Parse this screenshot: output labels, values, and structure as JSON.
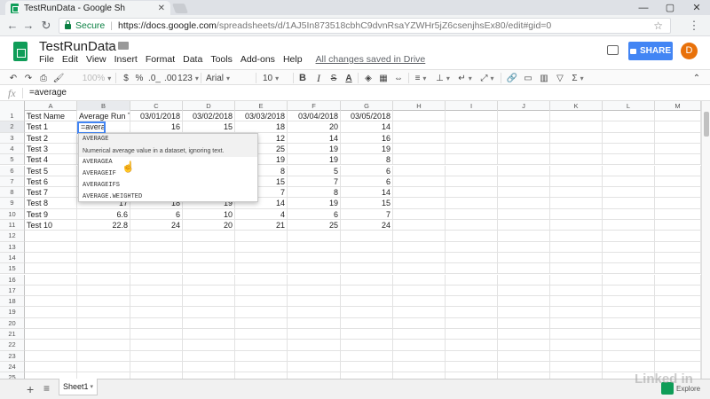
{
  "browser": {
    "tab_title": "TestRunData - Google Sh",
    "tab_close": "✕",
    "secure_label": "Secure",
    "url_host": "https://docs.google.com",
    "url_path": "/spreadsheets/d/1AJ5In873518cbhC9dvnRsaYZWHr5jZ6csenjhsEx80/edit#gid=0"
  },
  "app": {
    "doc_title": "TestRunData",
    "menus": [
      "File",
      "Edit",
      "View",
      "Insert",
      "Format",
      "Data",
      "Tools",
      "Add-ons",
      "Help"
    ],
    "save_status": "All changes saved in Drive",
    "share_label": "SHARE",
    "avatar_letter": "D"
  },
  "toolbar": {
    "zoom": "100%",
    "currency": "$",
    "percent": "%",
    "decrease_decimal": ".0_",
    "increase_decimal": ".00",
    "more_formats": "123",
    "font": "Arial",
    "font_size": "10",
    "bold": "B",
    "italic": "I",
    "strike": "S",
    "text_color": "A"
  },
  "formula_bar": {
    "fx_label": "fx",
    "content": "=average"
  },
  "grid": {
    "columns": [
      "A",
      "B",
      "C",
      "D",
      "E",
      "F",
      "G",
      "H",
      "I",
      "J",
      "K",
      "L",
      "M"
    ],
    "row_numbers": [
      "1",
      "2",
      "3",
      "4",
      "5",
      "6",
      "7",
      "8",
      "9",
      "10",
      "11",
      "12",
      "13",
      "14",
      "15",
      "16",
      "17",
      "18",
      "19",
      "20",
      "21",
      "22",
      "23",
      "24",
      "25"
    ],
    "rows": [
      [
        "Test Name",
        "Average Run Tim",
        "03/01/2018",
        "03/02/2018",
        "03/03/2018",
        "03/04/2018",
        "03/05/2018"
      ],
      [
        "Test 1",
        "",
        "16",
        "15",
        "18",
        "20",
        "14"
      ],
      [
        "Test 2",
        "",
        "",
        "",
        "12",
        "14",
        "16"
      ],
      [
        "Test 3",
        "",
        "",
        "",
        "25",
        "19",
        "19"
      ],
      [
        "Test 4",
        "",
        "",
        "",
        "19",
        "19",
        "8"
      ],
      [
        "Test 5",
        "",
        "",
        "",
        "8",
        "5",
        "6"
      ],
      [
        "Test 6",
        "",
        "",
        "",
        "15",
        "7",
        "6"
      ],
      [
        "Test 7",
        "",
        "",
        "",
        "7",
        "8",
        "14"
      ],
      [
        "Test 8",
        "17",
        "18",
        "19",
        "14",
        "19",
        "15"
      ],
      [
        "Test 9",
        "6.6",
        "6",
        "10",
        "4",
        "6",
        "7"
      ],
      [
        "Test 10",
        "22.8",
        "24",
        "20",
        "21",
        "25",
        "24"
      ]
    ],
    "active_cell_content": "=average("
  },
  "autocomplete": {
    "items": [
      "AVERAGE",
      "AVERAGEA",
      "AVERAGEIF",
      "AVERAGEIFS",
      "AVERAGE.WEIGHTED"
    ],
    "description": "Numerical average value in a dataset, ignoring text."
  },
  "bottom": {
    "add_sheet": "+",
    "all_sheets": "≡",
    "sheet_name": "Sheet1",
    "explore_label": "Explore"
  },
  "watermark": "Linked in"
}
